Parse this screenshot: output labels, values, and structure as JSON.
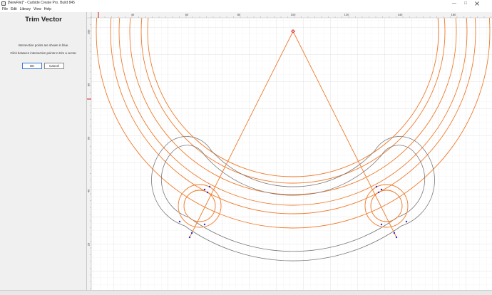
{
  "window": {
    "title": "[NewFile]* - Carbide Create Pro. Build 845",
    "min_glyph": "—",
    "max_glyph": "□"
  },
  "menu": {
    "items": [
      "File",
      "Edit",
      "Library",
      "View",
      "Help"
    ]
  },
  "panel": {
    "title": "Trim Vector",
    "line1": "Intersection points are shown in blue.",
    "line2": "Click between intersection points to trim a vector.",
    "ok_label": "OK",
    "cancel_label": "Cancel"
  },
  "ruler": {
    "top_labels": [
      "40",
      "60",
      "80",
      "100",
      "120",
      "140",
      "160"
    ],
    "left_labels": [
      "100",
      "80",
      "60",
      "40",
      "20"
    ]
  },
  "colors": {
    "vector_orange": "#f07a2a",
    "vector_gray": "#7a7a7a",
    "intersection_blue": "#2b2bd8",
    "ruler_marker": "#d02020",
    "grid": "#e4e4e4"
  }
}
